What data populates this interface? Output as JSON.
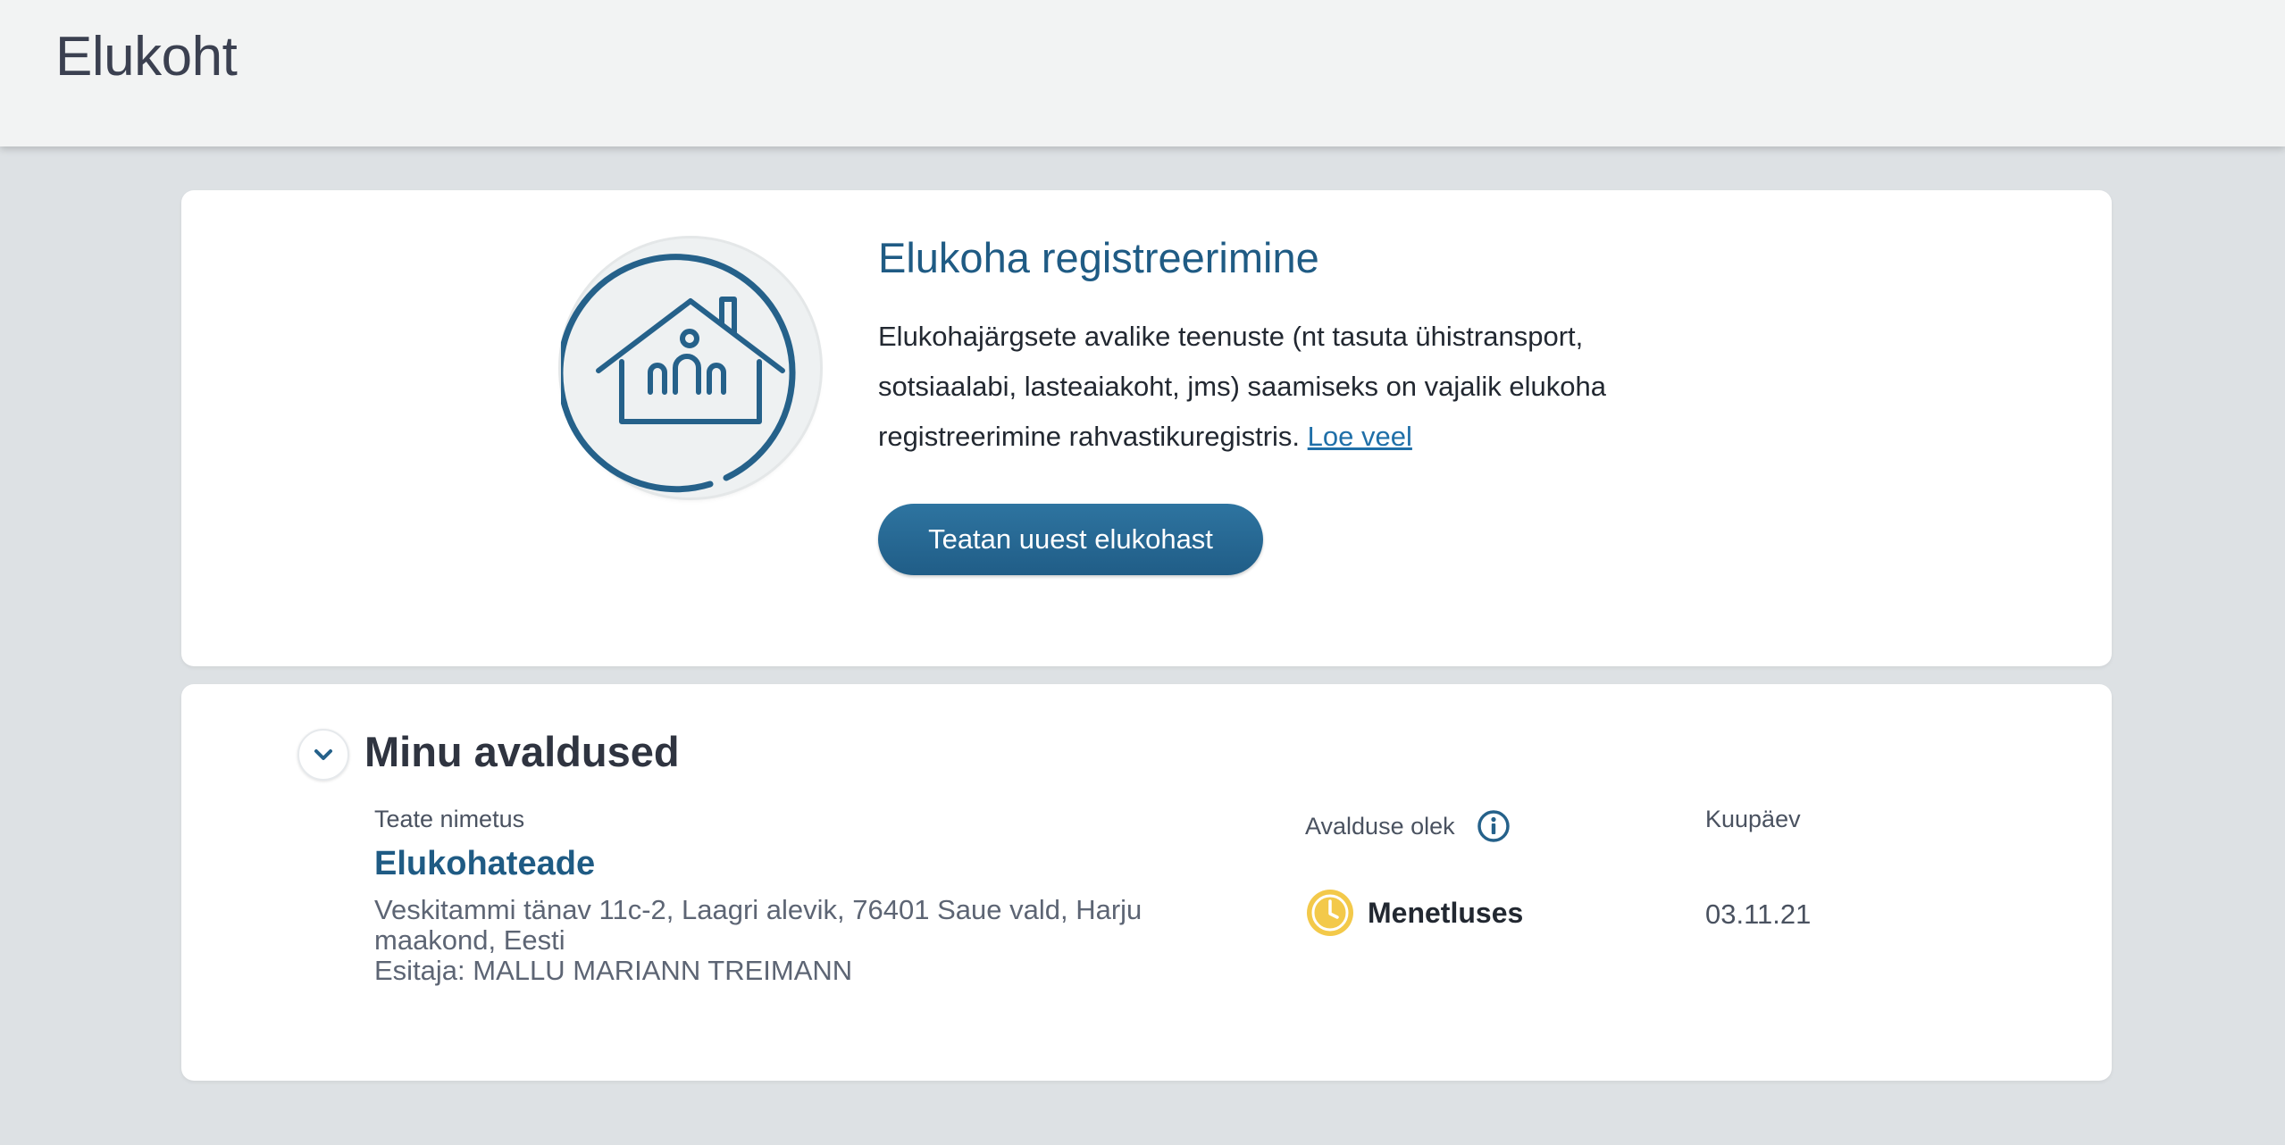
{
  "header": {
    "title": "Elukoht"
  },
  "registration": {
    "title": "Elukoha registreerimine",
    "description": "Elukohajärgsete avalike teenuste (nt tasuta ühistransport, sotsiaalabi, lasteaiakoht, jms) saamiseks on vajalik elukoha registreerimine rahvastikuregistris.",
    "read_more_label": "Loe veel",
    "button_label": "Teatan uuest elukohast",
    "icon": "house-icon"
  },
  "applications": {
    "title": "Minu avaldused",
    "columns": {
      "name": "Teate nimetus",
      "status": "Avalduse olek",
      "date": "Kuupäev"
    },
    "items": [
      {
        "title": "Elukohateade",
        "address": "Veskitammi tänav 11c-2, Laagri alevik, 76401 Saue vald, Harju maakond, Eesti",
        "submitter": "Esitaja: MALLU MARIANN TREIMANN",
        "status": "Menetluses",
        "status_icon": "clock-icon",
        "date": "03.11.21"
      }
    ]
  },
  "colors": {
    "accent": "#1f5b84",
    "link": "#1f6fa8",
    "status_pending": "#f3c94a",
    "background": "#dde1e4"
  }
}
